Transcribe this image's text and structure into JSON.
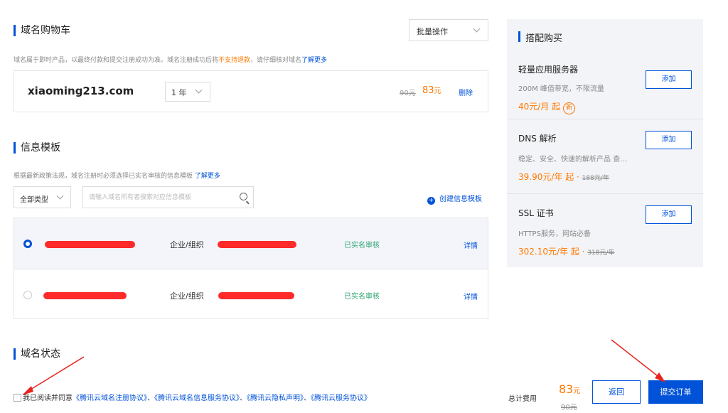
{
  "cart": {
    "title": "域名购物车",
    "batch_label": "批量操作",
    "hint_pre": "域名属于即时产品，以最终付款和提交注册成功为准。域名注册成功后将",
    "hint_warn": "不支持退款",
    "hint_post": "，请仔细核对域名",
    "hint_link": "了解更多",
    "item": {
      "domain": "xiaoming213.com",
      "years": "1 年",
      "old_price": "90元",
      "price": "83",
      "price_unit": "元",
      "delete": "删除"
    }
  },
  "template": {
    "title": "信息模板",
    "hint": "根据最新政策法规，域名注册时必须选择已实名审核的信息模板",
    "hint_link": "了解更多",
    "type_select": "全部类型",
    "search_placeholder": "请输入域名所有者搜索对应信息模板",
    "create_label": "创建信息模板",
    "rows": [
      {
        "type": "企业/组织",
        "status": "已实名审核",
        "detail": "详情",
        "selected": true
      },
      {
        "type": "企业/组织",
        "status": "已实名审核",
        "detail": "详情",
        "selected": false
      }
    ]
  },
  "status_title": "域名状态",
  "sidebar": {
    "title": "搭配购买",
    "items": [
      {
        "name": "轻量应用服务器",
        "desc": "200M 峰值带宽，不限流量",
        "price": "40元/月 起",
        "orig": "",
        "badge": "新",
        "button": "添加"
      },
      {
        "name": "DNS 解析",
        "desc": "稳定、安全、快速的解析产品 查...",
        "price": "39.90元/年 起",
        "orig": "188元/年",
        "badge": "",
        "button": "添加"
      },
      {
        "name": "SSL 证书",
        "desc": "HTTPS服务，网站必备",
        "price": "302.10元/年 起",
        "orig": "318元/年",
        "badge": "",
        "button": "添加"
      }
    ]
  },
  "footer": {
    "agree_text": "我已阅读并同意",
    "agreements": [
      "《腾讯云域名注册协议》",
      "《腾讯云域名信息服务协议》",
      "《腾讯云隐私声明》",
      "《腾讯云服务协议》"
    ],
    "sep": "、",
    "total_label": "总计费用",
    "total_price": "83",
    "total_unit": "元",
    "total_orig": "90元",
    "back": "返回",
    "submit": "提交订单"
  },
  "colors": {
    "accent": "#0052d9",
    "price": "#ff7800",
    "success": "#2ba471",
    "annotation": "#e8231f"
  }
}
